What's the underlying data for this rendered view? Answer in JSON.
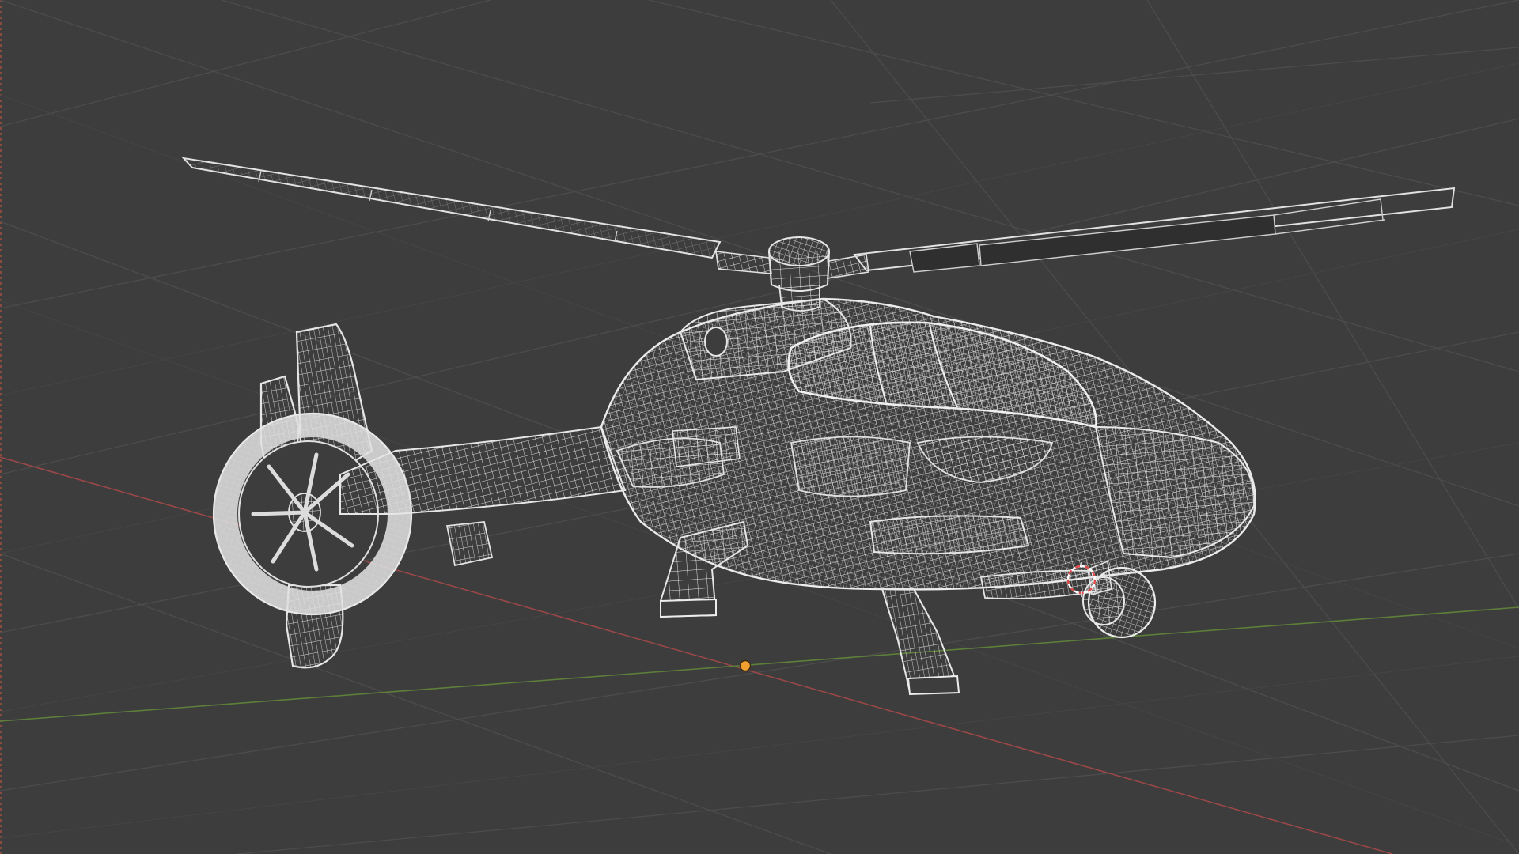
{
  "viewport": {
    "mode": "wireframe",
    "object": "helicopter",
    "colors": {
      "background": "#3d3d3d",
      "grid": "#4f4f4f",
      "x_axis": "#9a4747",
      "y_axis": "#5d7f3a",
      "wire": "#d9d9d9",
      "wire_dense": "#bdbdbd",
      "origin": "#f0a030",
      "cursor_red": "#e04848",
      "cursor_white": "#ffffff"
    }
  }
}
